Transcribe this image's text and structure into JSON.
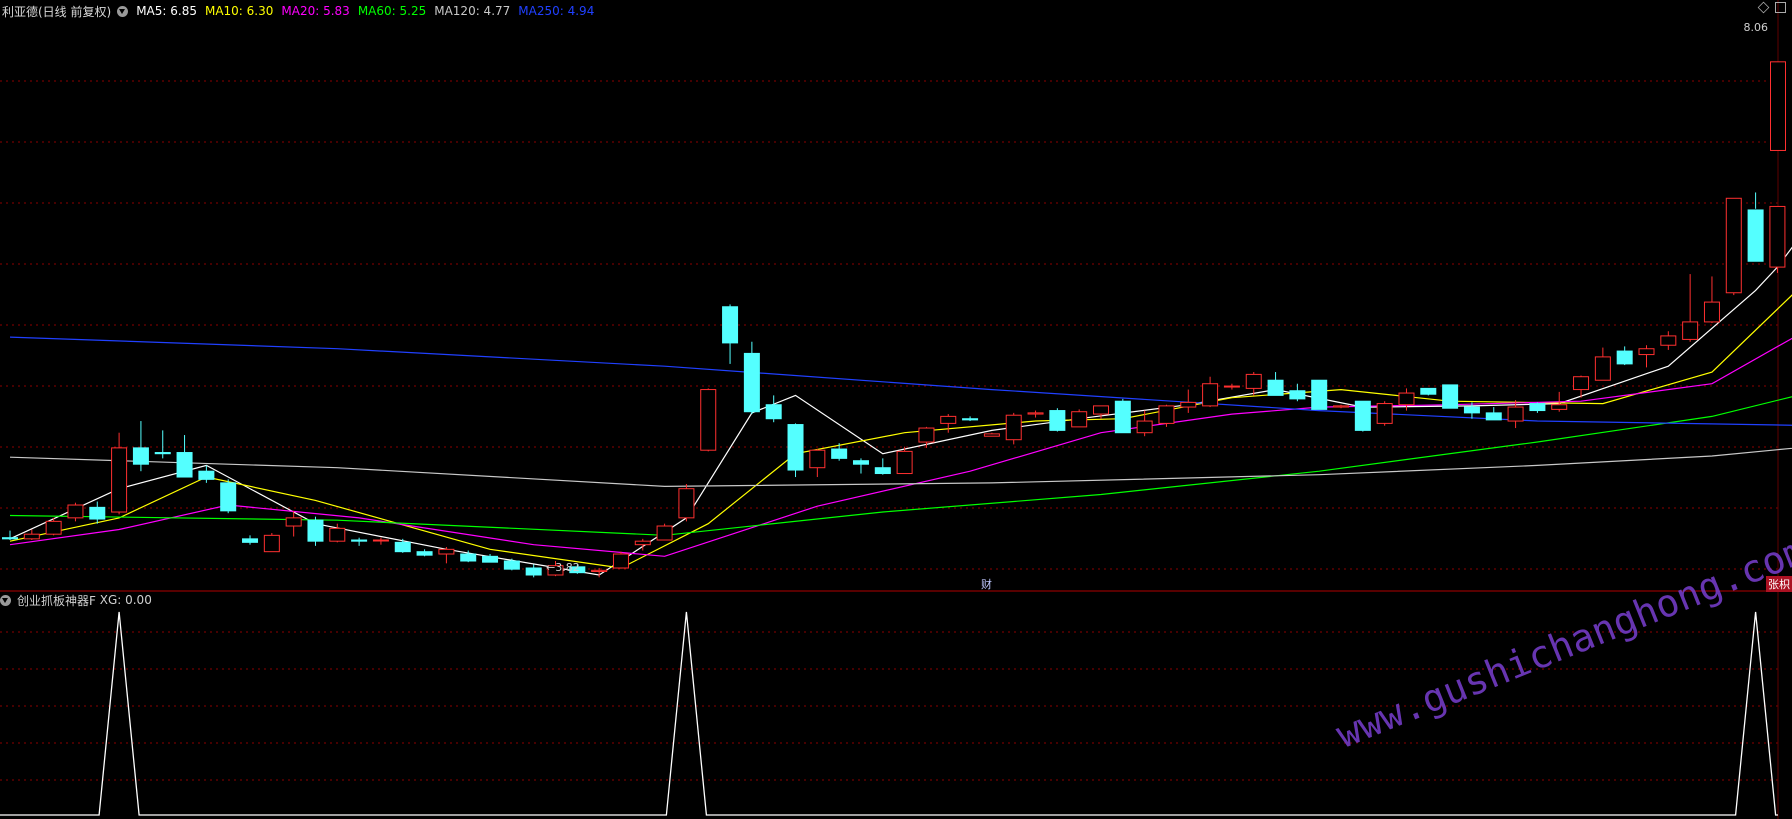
{
  "header": {
    "title": "利亚德(日线 前复权)",
    "ma": [
      {
        "label": "MA5: 6.85",
        "color": "#ffffff"
      },
      {
        "label": "MA10: 6.30",
        "color": "#ffff00"
      },
      {
        "label": "MA20: 5.83",
        "color": "#ff00ff"
      },
      {
        "label": "MA60: 5.25",
        "color": "#00ff00"
      },
      {
        "label": "MA120: 4.77",
        "color": "#c8c8c8"
      },
      {
        "label": "MA250: 4.94",
        "color": "#2040ff"
      }
    ]
  },
  "indicator": {
    "name": "创业抓板神器F",
    "xg": "XG: 0.00"
  },
  "labels": {
    "high": "8.06",
    "low": "3.82",
    "cai": "财",
    "zhang": "张枳"
  },
  "watermark": "www.gushichanghong.com",
  "colors": {
    "up": "#ff3030",
    "down": "#54ffff",
    "grid": "#8b0000"
  },
  "chart_data": {
    "type": "candlestick",
    "ylim": [
      3.6,
      8.35
    ],
    "candles": [
      [
        3.98,
        4.04,
        3.96,
        3.97
      ],
      [
        3.97,
        4.05,
        3.96,
        4.01
      ],
      [
        4.01,
        4.15,
        4.0,
        4.12
      ],
      [
        4.15,
        4.28,
        4.12,
        4.26
      ],
      [
        4.24,
        4.29,
        4.1,
        4.14
      ],
      [
        4.2,
        4.88,
        4.18,
        4.75
      ],
      [
        4.75,
        4.98,
        4.55,
        4.61
      ],
      [
        4.71,
        4.9,
        4.66,
        4.7
      ],
      [
        4.71,
        4.86,
        4.52,
        4.5
      ],
      [
        4.55,
        4.6,
        4.45,
        4.48
      ],
      [
        4.45,
        4.48,
        4.19,
        4.21
      ],
      [
        3.97,
        4.0,
        3.92,
        3.94
      ],
      [
        3.86,
        4.02,
        3.86,
        4.0
      ],
      [
        4.08,
        4.21,
        3.99,
        4.15
      ],
      [
        4.13,
        4.16,
        3.91,
        3.95
      ],
      [
        3.95,
        4.1,
        3.94,
        4.06
      ],
      [
        3.96,
        3.98,
        3.91,
        3.95
      ],
      [
        3.96,
        3.98,
        3.92,
        3.96
      ],
      [
        3.94,
        3.97,
        3.85,
        3.86
      ],
      [
        3.86,
        3.88,
        3.82,
        3.83
      ],
      [
        3.84,
        3.9,
        3.76,
        3.88
      ],
      [
        3.84,
        3.87,
        3.77,
        3.78
      ],
      [
        3.82,
        3.84,
        3.77,
        3.77
      ],
      [
        3.78,
        3.8,
        3.7,
        3.71
      ],
      [
        3.72,
        3.75,
        3.64,
        3.66
      ],
      [
        3.66,
        3.78,
        3.65,
        3.74
      ],
      [
        3.73,
        3.75,
        3.67,
        3.68
      ],
      [
        3.69,
        3.72,
        3.64,
        3.7
      ],
      [
        3.72,
        3.86,
        3.72,
        3.84
      ],
      [
        3.92,
        3.97,
        3.87,
        3.95
      ],
      [
        3.96,
        4.1,
        3.96,
        4.08
      ],
      [
        4.15,
        4.44,
        4.12,
        4.4
      ],
      [
        4.73,
        5.26,
        4.72,
        5.25
      ],
      [
        5.96,
        5.98,
        5.47,
        5.65
      ],
      [
        5.56,
        5.66,
        5.04,
        5.06
      ],
      [
        5.12,
        5.2,
        4.97,
        5.0
      ],
      [
        4.95,
        4.96,
        4.5,
        4.56
      ],
      [
        4.58,
        4.74,
        4.5,
        4.73
      ],
      [
        4.74,
        4.79,
        4.64,
        4.66
      ],
      [
        4.64,
        4.66,
        4.53,
        4.61
      ],
      [
        4.58,
        4.66,
        4.52,
        4.53
      ],
      [
        4.53,
        4.76,
        4.53,
        4.72
      ],
      [
        4.8,
        4.93,
        4.75,
        4.92
      ],
      [
        4.96,
        5.04,
        4.88,
        5.02
      ],
      [
        5.0,
        5.02,
        4.98,
        4.99
      ],
      [
        4.85,
        4.88,
        4.85,
        4.87
      ],
      [
        4.82,
        5.05,
        4.78,
        5.03
      ],
      [
        5.04,
        5.07,
        5.01,
        5.05
      ],
      [
        5.07,
        5.09,
        4.89,
        4.9
      ],
      [
        4.93,
        5.08,
        4.93,
        5.06
      ],
      [
        5.04,
        5.1,
        5.0,
        5.11
      ],
      [
        5.15,
        5.17,
        4.88,
        4.88
      ],
      [
        4.88,
        5.07,
        4.85,
        4.98
      ],
      [
        4.96,
        5.12,
        4.93,
        5.11
      ],
      [
        5.1,
        5.25,
        5.05,
        5.14
      ],
      [
        5.11,
        5.36,
        5.1,
        5.3
      ],
      [
        5.28,
        5.3,
        5.25,
        5.28
      ],
      [
        5.26,
        5.4,
        5.2,
        5.38
      ],
      [
        5.33,
        5.4,
        5.2,
        5.2
      ],
      [
        5.24,
        5.3,
        5.15,
        5.17
      ],
      [
        5.33,
        5.33,
        5.09,
        5.08
      ],
      [
        5.1,
        5.12,
        5.09,
        5.11
      ],
      [
        5.15,
        5.15,
        4.89,
        4.9
      ],
      [
        4.96,
        5.15,
        4.94,
        5.13
      ],
      [
        5.12,
        5.26,
        5.07,
        5.22
      ],
      [
        5.26,
        5.26,
        5.2,
        5.21
      ],
      [
        5.29,
        5.29,
        5.09,
        5.09
      ],
      [
        5.1,
        5.14,
        5.0,
        5.05
      ],
      [
        5.05,
        5.1,
        4.99,
        4.99
      ],
      [
        4.98,
        5.16,
        4.92,
        5.1
      ],
      [
        5.13,
        5.14,
        5.05,
        5.07
      ],
      [
        5.08,
        5.23,
        5.06,
        5.12
      ],
      [
        5.25,
        5.37,
        5.18,
        5.36
      ],
      [
        5.33,
        5.61,
        5.33,
        5.53
      ],
      [
        5.58,
        5.62,
        5.46,
        5.47
      ],
      [
        5.55,
        5.63,
        5.44,
        5.6
      ],
      [
        5.63,
        5.75,
        5.59,
        5.71
      ],
      [
        5.68,
        6.24,
        5.66,
        5.83
      ],
      [
        5.83,
        6.22,
        5.82,
        6.0
      ],
      [
        6.08,
        6.87,
        6.06,
        6.89
      ],
      [
        6.79,
        6.94,
        6.8,
        6.35
      ],
      [
        6.3,
        6.39,
        6.25,
        6.82
      ]
    ],
    "extra_candle": {
      "open": 7.3,
      "high": 8.06,
      "low": 7.3,
      "close": 8.06
    },
    "ma_series": [
      {
        "name": "MA5",
        "color": "#ffffff",
        "points": [
          [
            0,
            3.97
          ],
          [
            5,
            4.4
          ],
          [
            9,
            4.6
          ],
          [
            14,
            4.1
          ],
          [
            20,
            3.88
          ],
          [
            27,
            3.66
          ],
          [
            31,
            4.15
          ],
          [
            34,
            5.05
          ],
          [
            36,
            5.2
          ],
          [
            40,
            4.7
          ],
          [
            45,
            4.9
          ],
          [
            49,
            5.0
          ],
          [
            54,
            5.12
          ],
          [
            58,
            5.25
          ],
          [
            62,
            5.1
          ],
          [
            67,
            5.11
          ],
          [
            71,
            5.13
          ],
          [
            76,
            5.45
          ],
          [
            80,
            6.1
          ],
          [
            81,
            6.3
          ],
          [
            83,
            6.8
          ]
        ]
      },
      {
        "name": "MA10",
        "color": "#ffff00",
        "points": [
          [
            0,
            3.95
          ],
          [
            5,
            4.15
          ],
          [
            9,
            4.5
          ],
          [
            14,
            4.3
          ],
          [
            22,
            3.88
          ],
          [
            28,
            3.72
          ],
          [
            32,
            4.1
          ],
          [
            36,
            4.7
          ],
          [
            41,
            4.88
          ],
          [
            47,
            4.98
          ],
          [
            51,
            5.0
          ],
          [
            56,
            5.18
          ],
          [
            61,
            5.25
          ],
          [
            66,
            5.15
          ],
          [
            73,
            5.13
          ],
          [
            78,
            5.4
          ],
          [
            83,
            6.3
          ]
        ]
      },
      {
        "name": "MA20",
        "color": "#ff00ff",
        "points": [
          [
            0,
            3.92
          ],
          [
            5,
            4.05
          ],
          [
            10,
            4.26
          ],
          [
            16,
            4.15
          ],
          [
            24,
            3.92
          ],
          [
            30,
            3.82
          ],
          [
            37,
            4.25
          ],
          [
            44,
            4.55
          ],
          [
            50,
            4.88
          ],
          [
            56,
            5.04
          ],
          [
            60,
            5.1
          ],
          [
            66,
            5.12
          ],
          [
            72,
            5.15
          ],
          [
            78,
            5.3
          ],
          [
            83,
            5.83
          ]
        ]
      },
      {
        "name": "MA60",
        "color": "#00ff00",
        "points": [
          [
            0,
            4.17
          ],
          [
            15,
            4.13
          ],
          [
            30,
            4.0
          ],
          [
            40,
            4.2
          ],
          [
            50,
            4.35
          ],
          [
            60,
            4.55
          ],
          [
            70,
            4.8
          ],
          [
            78,
            5.02
          ],
          [
            83,
            5.25
          ]
        ]
      },
      {
        "name": "MA120",
        "color": "#c8c8c8",
        "points": [
          [
            0,
            4.67
          ],
          [
            15,
            4.58
          ],
          [
            30,
            4.42
          ],
          [
            45,
            4.45
          ],
          [
            60,
            4.52
          ],
          [
            70,
            4.6
          ],
          [
            78,
            4.68
          ],
          [
            83,
            4.77
          ]
        ]
      },
      {
        "name": "MA250",
        "color": "#2040ff",
        "points": [
          [
            0,
            5.7
          ],
          [
            15,
            5.6
          ],
          [
            30,
            5.45
          ],
          [
            45,
            5.25
          ],
          [
            60,
            5.07
          ],
          [
            70,
            4.98
          ],
          [
            83,
            4.94
          ]
        ]
      }
    ],
    "indicator_spikes": [
      5,
      31,
      80
    ],
    "indicator_ylim": [
      0,
      1
    ]
  }
}
